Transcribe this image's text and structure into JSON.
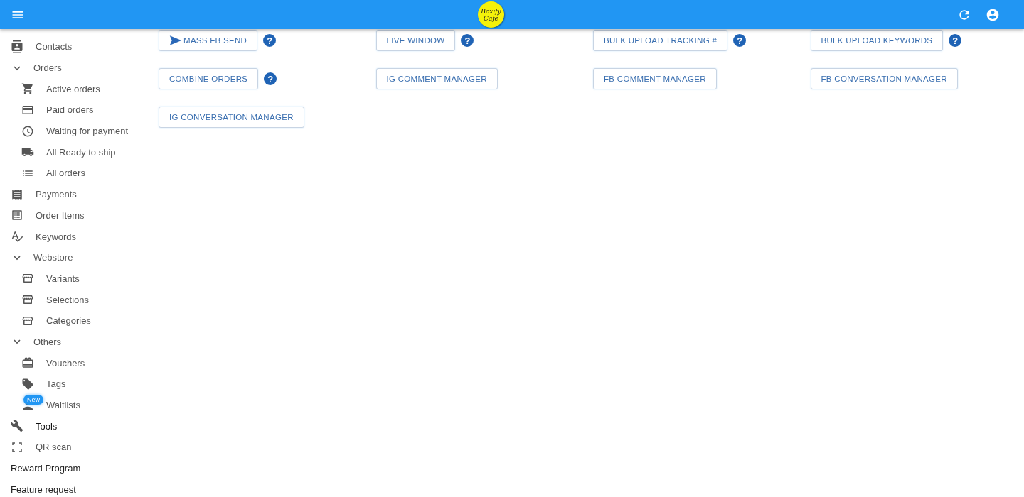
{
  "header": {
    "logo": [
      "Boxify",
      "Café"
    ]
  },
  "sidebar": {
    "items": [
      {
        "kind": "item",
        "label": "Contacts",
        "selected": false
      },
      {
        "kind": "group",
        "label": "Orders",
        "expanded": true,
        "children": [
          {
            "kind": "item",
            "label": "Active orders",
            "selected": false
          },
          {
            "kind": "item",
            "label": "Paid orders",
            "selected": false
          },
          {
            "kind": "item",
            "label": "Waiting for payment",
            "selected": false
          },
          {
            "kind": "item",
            "label": "All Ready to ship",
            "selected": false
          },
          {
            "kind": "item",
            "label": "All orders",
            "selected": false
          }
        ]
      },
      {
        "kind": "item",
        "label": "Payments",
        "selected": false
      },
      {
        "kind": "item",
        "label": "Order Items",
        "selected": false
      },
      {
        "kind": "item",
        "label": "Keywords",
        "selected": false
      },
      {
        "kind": "group",
        "label": "Webstore",
        "expanded": true,
        "children": [
          {
            "kind": "item",
            "label": "Variants",
            "selected": false
          },
          {
            "kind": "item",
            "label": "Selections",
            "selected": false
          },
          {
            "kind": "item",
            "label": "Categories",
            "selected": false
          }
        ]
      },
      {
        "kind": "group",
        "label": "Others",
        "expanded": true,
        "children": [
          {
            "kind": "item",
            "label": "Vouchers",
            "selected": false
          },
          {
            "kind": "item",
            "label": "Tags",
            "selected": false
          },
          {
            "kind": "item",
            "label": "Waitlists",
            "selected": false,
            "badge": "New"
          }
        ]
      },
      {
        "kind": "item",
        "label": "Tools",
        "selected": true
      },
      {
        "kind": "item",
        "label": "QR scan",
        "selected": false
      },
      {
        "kind": "link",
        "label": "Reward Program"
      },
      {
        "kind": "link",
        "label": "Feature request"
      }
    ]
  },
  "tools": [
    {
      "label": "MASS FB SEND",
      "help": "?",
      "icon": true
    },
    {
      "label": "LIVE WINDOW",
      "help": "?",
      "icon": false
    },
    {
      "label": "BULK UPLOAD TRACKING #",
      "help": "?",
      "icon": false
    },
    {
      "label": "BULK UPLOAD KEYWORDS",
      "help": "?",
      "icon": false
    },
    {
      "label": "COMBINE ORDERS",
      "help": "?",
      "icon": false
    },
    {
      "label": "IG COMMENT MANAGER",
      "icon": false
    },
    {
      "label": "FB COMMENT MANAGER",
      "icon": false
    },
    {
      "label": "FB CONVERSATION MANAGER",
      "icon": false
    },
    {
      "label": "IG CONVERSATION MANAGER",
      "icon": false
    }
  ]
}
